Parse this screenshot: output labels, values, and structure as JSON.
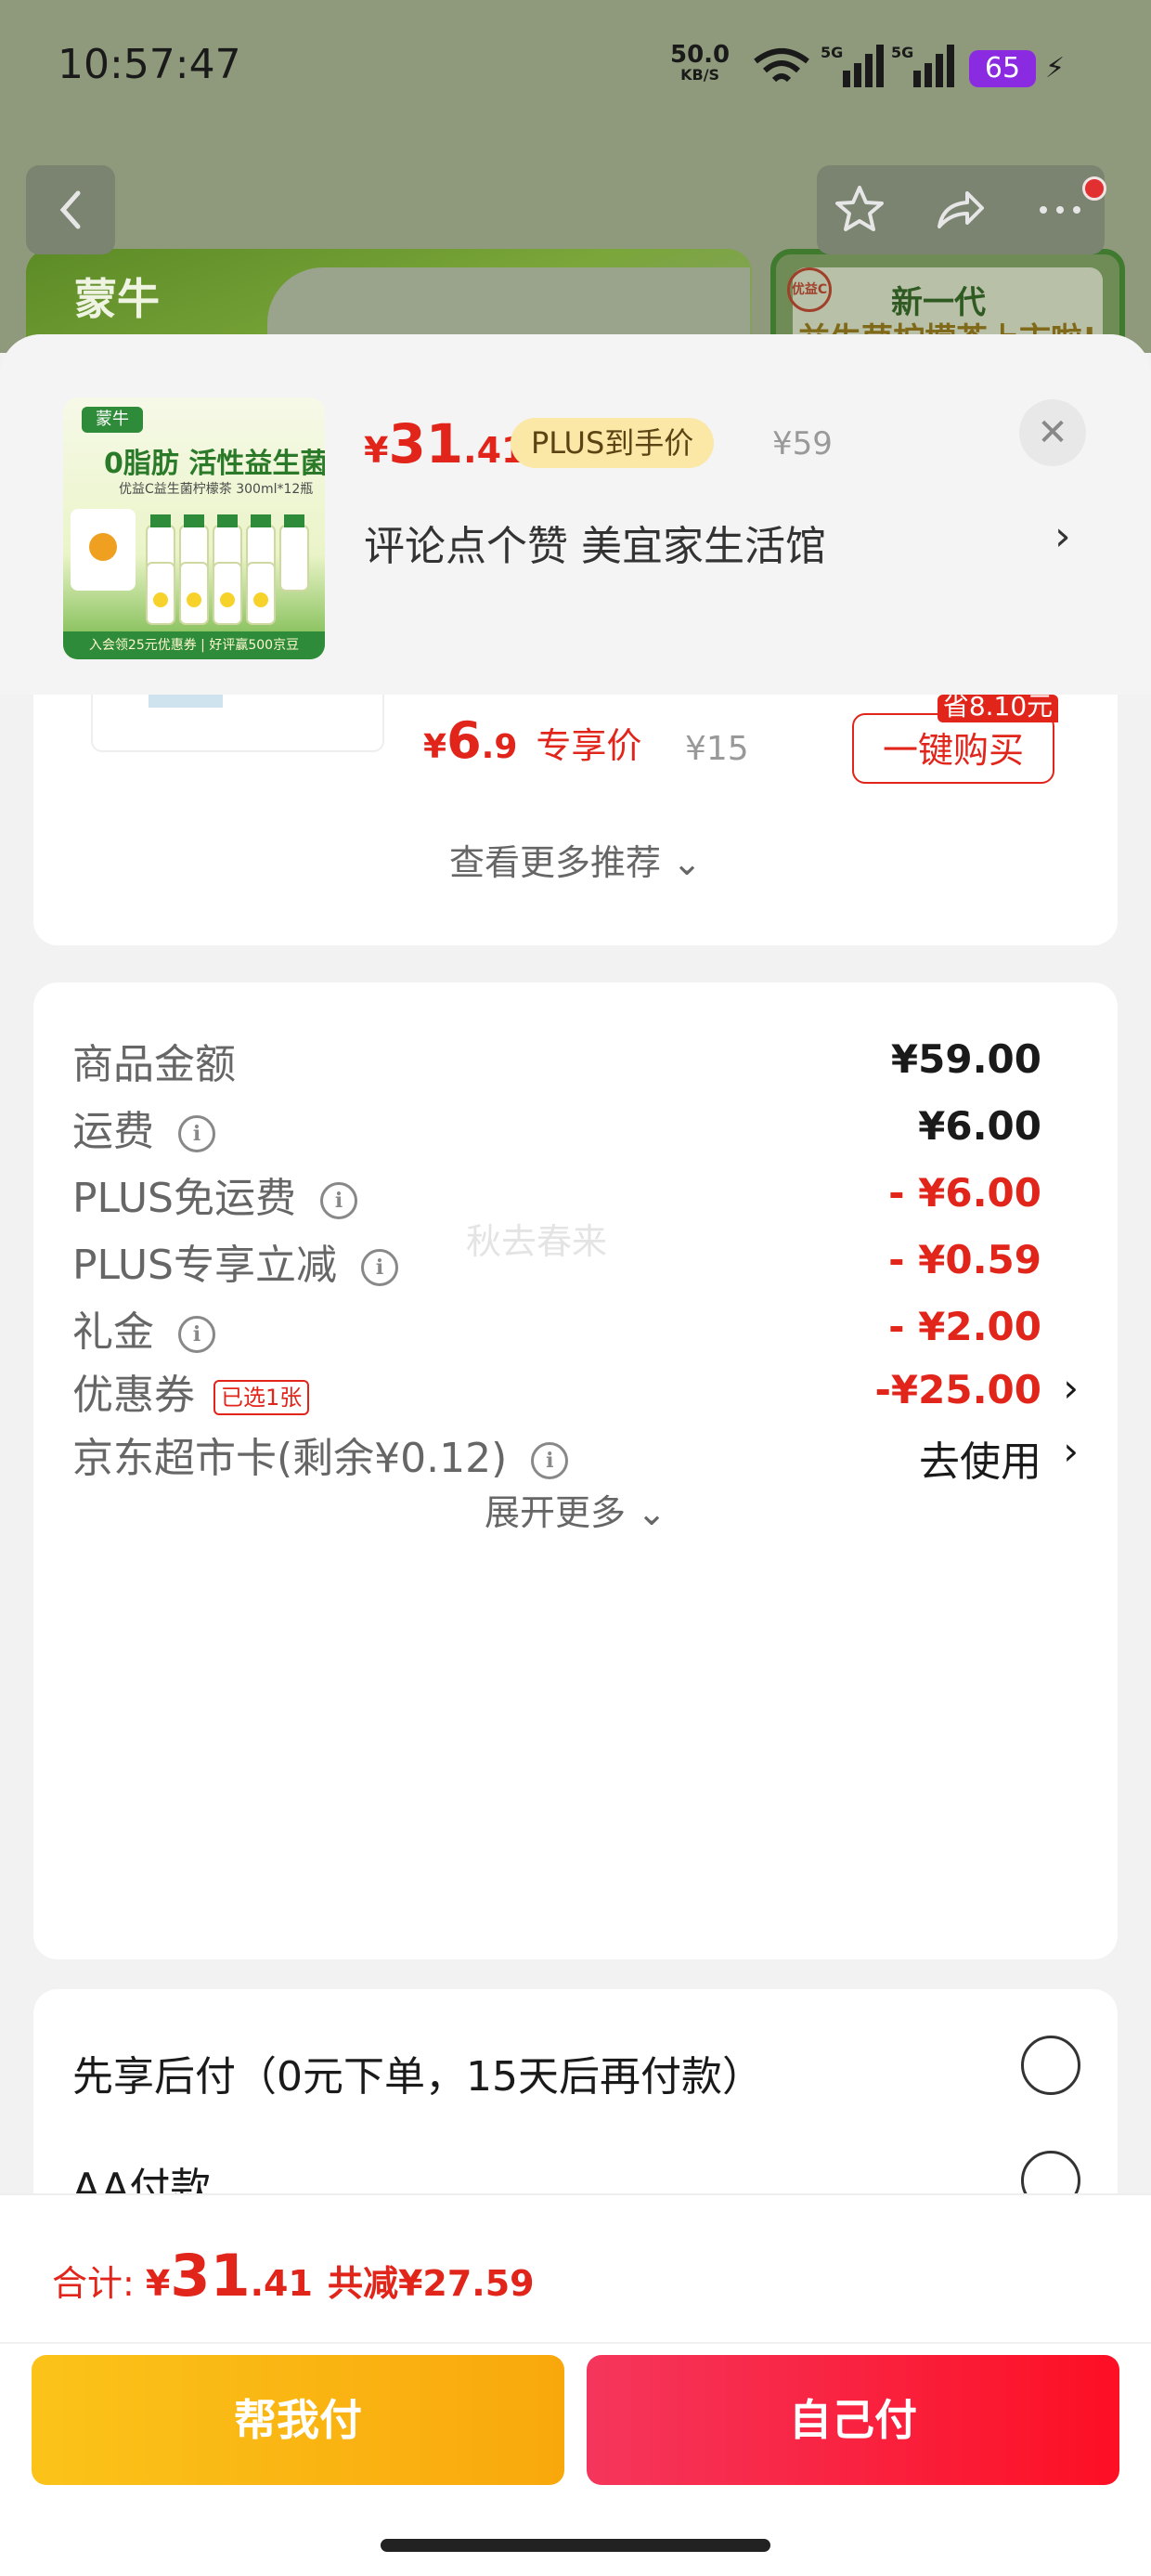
{
  "status_bar": {
    "time": "10:57:47",
    "net_speed": "50.0",
    "net_unit": "KB/S",
    "signal_label_1": "5G",
    "signal_label_2": "5G",
    "battery": "65"
  },
  "background": {
    "brand": "蒙牛",
    "promo_line1": "新一代",
    "promo_line2": "益生菌柠檬茶上市啦!",
    "seal": "优益C"
  },
  "product": {
    "thumb_logo": "蒙牛",
    "thumb_title": "0脂肪 活性益生菌",
    "thumb_subtitle": "优益C益生菌柠檬茶 300ml*12瓶",
    "thumb_bar": "入会领25元优惠券 | 好评赢500京豆",
    "price_symbol": "¥",
    "price_int": "31",
    "price_dec": ".41",
    "plus_tag": "PLUS到手价",
    "original_price": "¥59",
    "shop": "评论点个赞  美宜家生活馆",
    "shop_chevron": "›",
    "close": "✕"
  },
  "recommend": {
    "save_tag": "省8.10元",
    "price_symbol": "¥",
    "price_int": "6",
    "price_dec": ".9",
    "price_label": "专享价",
    "original_price": "¥15",
    "buy_button": "一键购买",
    "more": "查看更多推荐 ⌄"
  },
  "amounts": {
    "watermark": "秋去春来",
    "rows": [
      {
        "label": "商品金额",
        "value": "¥59.00"
      },
      {
        "label": "运费",
        "value": "¥6.00"
      },
      {
        "label": "PLUS免运费",
        "value": "- ¥6.00"
      },
      {
        "label": "PLUS专享立减",
        "value": "- ¥0.59"
      },
      {
        "label": "礼金",
        "value": "- ¥2.00"
      },
      {
        "label": "优惠券",
        "badge": "已选1张",
        "value": "-¥25.00"
      },
      {
        "label": "京东超市卡(剩余¥0.12)",
        "value": "去使用"
      }
    ],
    "info_glyph": "i",
    "chevron": "›",
    "expand": "展开更多 ⌄"
  },
  "payment": {
    "options": [
      {
        "label": "先享后付（0元下单，15天后再付款）"
      },
      {
        "label": "AA付款"
      }
    ]
  },
  "footer": {
    "total_label": "合计: ",
    "total_symbol": "¥",
    "total_int": "31",
    "total_dec": ".41",
    "total_saved": "共减¥27.59",
    "help_pay": "帮我付",
    "self_pay": "自己付"
  },
  "colors": {
    "accent_red": "#e1251b",
    "plus_gold": "#fbe7a6",
    "help_btn": "#fbc31a",
    "self_btn": "#fd0f24"
  }
}
